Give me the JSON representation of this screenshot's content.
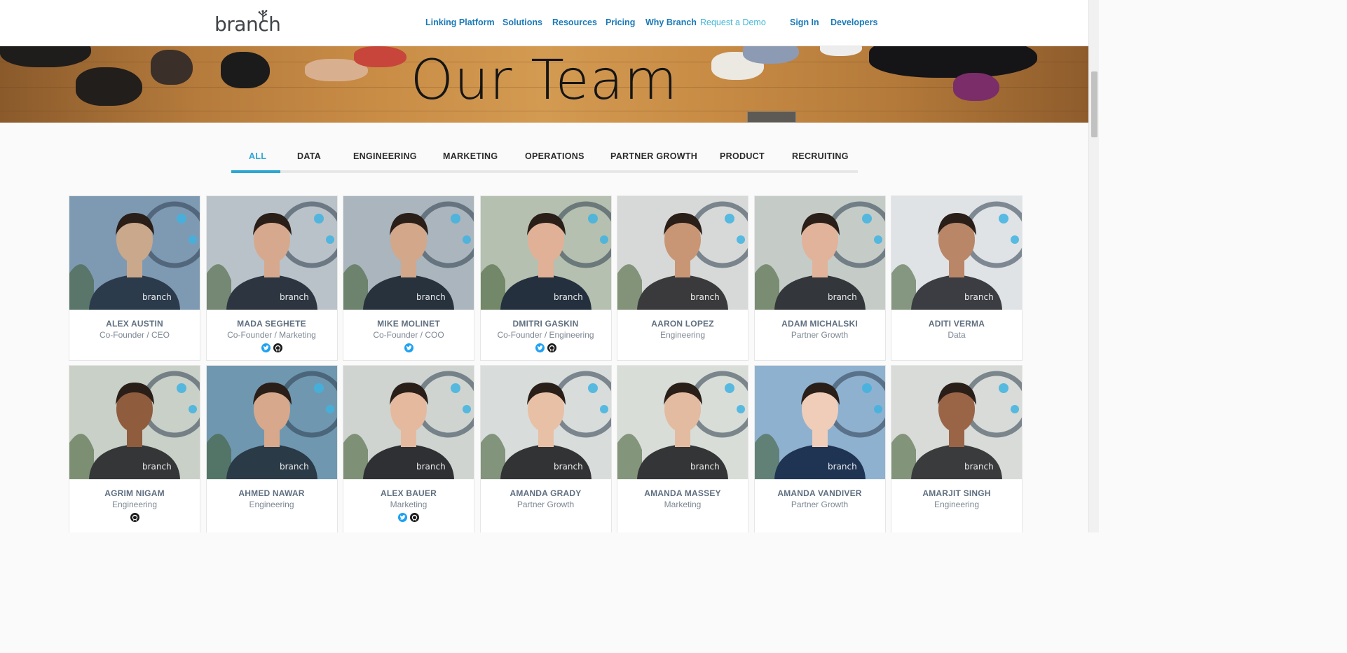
{
  "header": {
    "logo_text": "branch",
    "nav": [
      {
        "label": "Linking Platform",
        "name": "nav-linking-platform"
      },
      {
        "label": "Solutions",
        "name": "nav-solutions"
      },
      {
        "label": "Resources",
        "name": "nav-resources"
      },
      {
        "label": "Pricing",
        "name": "nav-pricing"
      },
      {
        "label": "Why Branch",
        "name": "nav-why-branch"
      },
      {
        "label": "Request a Demo",
        "name": "nav-request-demo"
      },
      {
        "label": "Sign In",
        "name": "nav-sign-in"
      },
      {
        "label": "Developers",
        "name": "nav-developers"
      }
    ]
  },
  "hero": {
    "title": "Our Team"
  },
  "tabs": [
    {
      "label": "ALL",
      "active": true
    },
    {
      "label": "DATA",
      "active": false
    },
    {
      "label": "ENGINEERING",
      "active": false
    },
    {
      "label": "MARKETING",
      "active": false
    },
    {
      "label": "OPERATIONS",
      "active": false
    },
    {
      "label": "PARTNER GROWTH",
      "active": false
    },
    {
      "label": "PRODUCT",
      "active": false
    },
    {
      "label": "RECRUITING",
      "active": false
    }
  ],
  "team": [
    {
      "name": "ALEX AUSTIN",
      "role": "Co-Founder / CEO",
      "social": []
    },
    {
      "name": "MADA SEGHETE",
      "role": "Co-Founder / Marketing",
      "social": [
        "twitter",
        "github"
      ]
    },
    {
      "name": "MIKE MOLINET",
      "role": "Co-Founder / COO",
      "social": [
        "twitter"
      ]
    },
    {
      "name": "DMITRI GASKIN",
      "role": "Co-Founder / Engineering",
      "social": [
        "twitter",
        "github"
      ]
    },
    {
      "name": "AARON LOPEZ",
      "role": "Engineering",
      "social": []
    },
    {
      "name": "ADAM MICHALSKI",
      "role": "Partner Growth",
      "social": []
    },
    {
      "name": "ADITI VERMA",
      "role": "Data",
      "social": []
    },
    {
      "name": "AGRIM NIGAM",
      "role": "Engineering",
      "social": [
        "github"
      ]
    },
    {
      "name": "AHMED NAWAR",
      "role": "Engineering",
      "social": []
    },
    {
      "name": "ALEX BAUER",
      "role": "Marketing",
      "social": [
        "twitter",
        "github"
      ]
    },
    {
      "name": "AMANDA GRADY",
      "role": "Partner Growth",
      "social": []
    },
    {
      "name": "AMANDA MASSEY",
      "role": "Marketing",
      "social": []
    },
    {
      "name": "AMANDA VANDIVER",
      "role": "Partner Growth",
      "social": []
    },
    {
      "name": "AMARJIT SINGH",
      "role": "Engineering",
      "social": []
    }
  ],
  "colors": {
    "accent": "#2ba7d4",
    "nav": "#1a7ab8",
    "name": "#5f6f80",
    "role": "#7d8893"
  }
}
